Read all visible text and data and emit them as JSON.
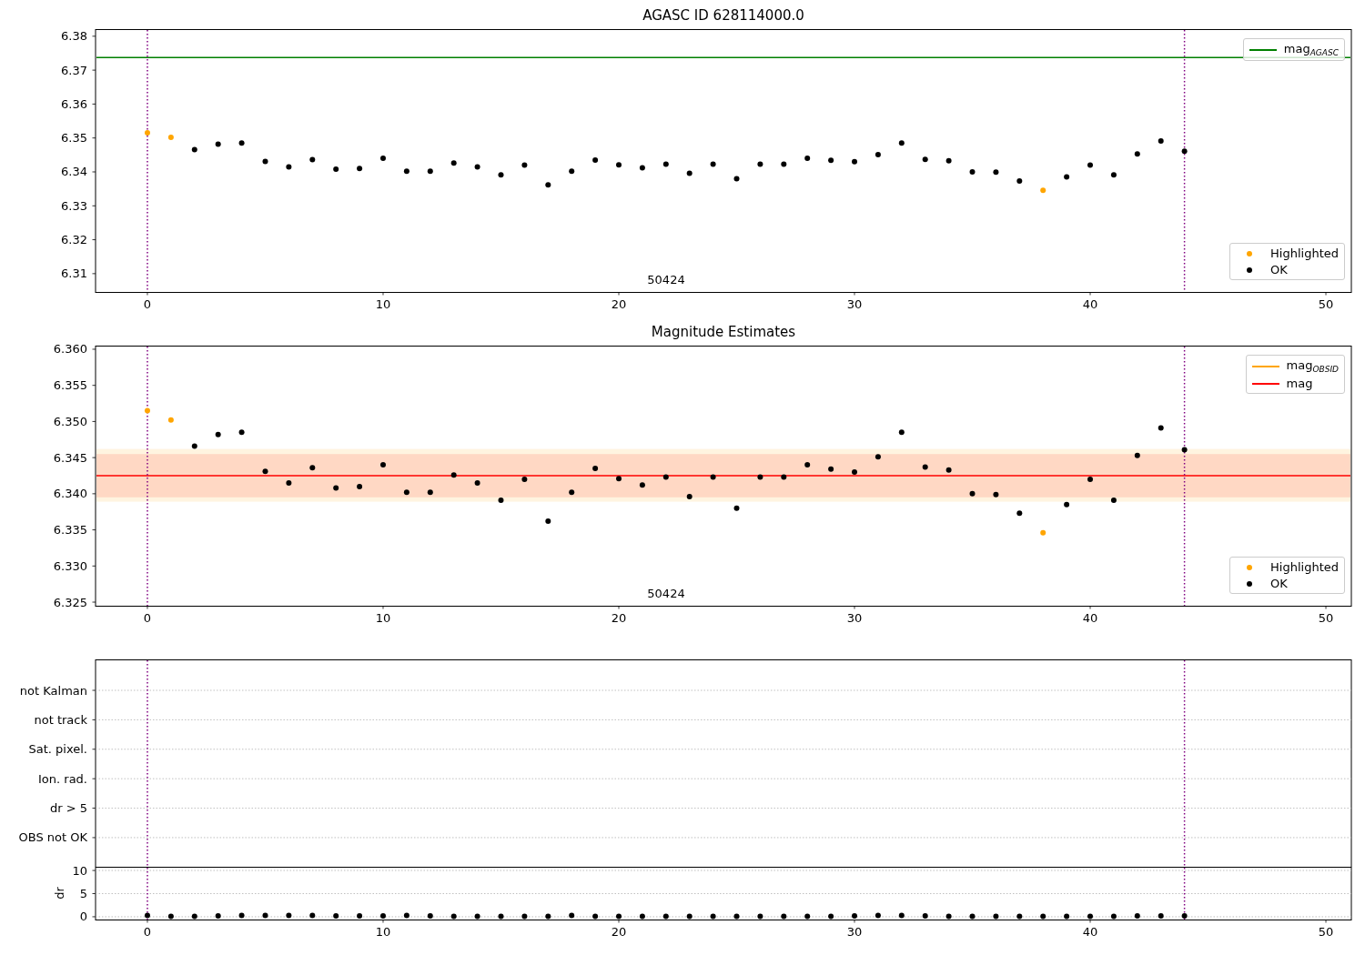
{
  "figure": {
    "panels": [
      {
        "chart_data": {
          "type": "scatter",
          "title": "AGASC ID 628114000.0",
          "legend": [
            "upper right",
            "lower right"
          ],
          "x": [
            0,
            1,
            2,
            3,
            4,
            5,
            6,
            7,
            8,
            9,
            10,
            11,
            12,
            13,
            14,
            15,
            16,
            17,
            18,
            19,
            20,
            21,
            22,
            23,
            24,
            25,
            26,
            27,
            28,
            29,
            30,
            31,
            32,
            33,
            34,
            35,
            36,
            37,
            38,
            39,
            40,
            41,
            42,
            43,
            44
          ],
          "xlim": [
            -2.2,
            51.08
          ],
          "ylim": [
            6.3046,
            6.3821
          ],
          "xticks": [
            0,
            10,
            20,
            30,
            40,
            50
          ],
          "yticks": [
            6.31,
            6.32,
            6.33,
            6.34,
            6.35,
            6.36,
            6.37,
            6.38
          ],
          "series": [
            {
              "name": "Highlighted",
              "color": "#ffa500",
              "values": [
                6.3515,
                6.3502,
                null,
                null,
                null,
                null,
                null,
                null,
                null,
                null,
                null,
                null,
                null,
                null,
                null,
                null,
                null,
                null,
                null,
                null,
                null,
                null,
                null,
                null,
                null,
                null,
                null,
                null,
                null,
                null,
                null,
                null,
                null,
                null,
                null,
                null,
                null,
                null,
                6.3346,
                null,
                null,
                null,
                null,
                null,
                null
              ]
            },
            {
              "name": "OK",
              "color": "#000000",
              "values": [
                null,
                null,
                6.3466,
                6.3482,
                6.3485,
                6.3431,
                6.3415,
                6.3436,
                6.3408,
                6.341,
                6.344,
                6.3402,
                6.3402,
                6.3426,
                6.3415,
                6.3391,
                6.342,
                6.3362,
                6.3402,
                6.3435,
                6.3421,
                6.3412,
                6.3423,
                6.3396,
                6.3423,
                6.338,
                6.3423,
                6.3423,
                6.344,
                6.3434,
                6.343,
                6.3451,
                6.3485,
                6.3437,
                6.3433,
                6.34,
                6.3399,
                6.3373,
                null,
                6.3385,
                6.342,
                6.3391,
                6.3453,
                6.3491,
                6.3461
              ]
            }
          ],
          "ref_lines": [
            {
              "axis": "y",
              "value": 6.3737,
              "label": "mag$_{AGASC}$",
              "color": "#008000"
            },
            {
              "axis": "x",
              "value": 0,
              "color": "#800080"
            },
            {
              "axis": "x",
              "value": 44,
              "color": "#800080"
            }
          ],
          "annotations": [
            "50424"
          ]
        }
      },
      {
        "chart_data": {
          "type": "scatter",
          "title": "Magnitude Estimates",
          "legend": [
            "upper right",
            "lower right"
          ],
          "x": [
            0,
            1,
            2,
            3,
            4,
            5,
            6,
            7,
            8,
            9,
            10,
            11,
            12,
            13,
            14,
            15,
            16,
            17,
            18,
            19,
            20,
            21,
            22,
            23,
            24,
            25,
            26,
            27,
            28,
            29,
            30,
            31,
            32,
            33,
            34,
            35,
            36,
            37,
            38,
            39,
            40,
            41,
            42,
            43,
            44
          ],
          "xlim": [
            -2.2,
            51.08
          ],
          "ylim": [
            6.3245,
            6.3605
          ],
          "xticks": [
            0,
            10,
            20,
            30,
            40,
            50
          ],
          "yticks": [
            6.325,
            {
              "value": 6.33,
              "label": "6.330"
            },
            6.335,
            {
              "value": 6.34,
              "label": "6.340"
            },
            6.345,
            {
              "value": 6.35,
              "label": "6.350"
            },
            6.355,
            {
              "value": 6.36,
              "label": "6.360"
            }
          ],
          "series": [
            {
              "name": "Highlighted",
              "color": "#ffa500",
              "values": [
                6.3515,
                6.3502,
                null,
                null,
                null,
                null,
                null,
                null,
                null,
                null,
                null,
                null,
                null,
                null,
                null,
                null,
                null,
                null,
                null,
                null,
                null,
                null,
                null,
                null,
                null,
                null,
                null,
                null,
                null,
                null,
                null,
                null,
                null,
                null,
                null,
                null,
                null,
                null,
                6.3346,
                null,
                null,
                null,
                null,
                null,
                null
              ]
            },
            {
              "name": "OK",
              "color": "#000000",
              "values": [
                null,
                null,
                6.3466,
                6.3482,
                6.3485,
                6.3431,
                6.3415,
                6.3436,
                6.3408,
                6.341,
                6.344,
                6.3402,
                6.3402,
                6.3426,
                6.3415,
                6.3391,
                6.342,
                6.3362,
                6.3402,
                6.3435,
                6.3421,
                6.3412,
                6.3423,
                6.3396,
                6.3423,
                6.338,
                6.3423,
                6.3423,
                6.344,
                6.3434,
                6.343,
                6.3451,
                6.3485,
                6.3437,
                6.3433,
                6.34,
                6.3399,
                6.3373,
                null,
                6.3385,
                6.342,
                6.3391,
                6.3453,
                6.3491,
                6.3461
              ]
            }
          ],
          "bands": [
            {
              "axis": "y",
              "from": 6.3395,
              "to": 6.3455,
              "color": "#ff0000"
            },
            {
              "axis": "y",
              "from": 6.3389,
              "to": 6.3462,
              "color": "#ffa500",
              "label": "mag$_{OBSID}$"
            }
          ],
          "ref_lines": [
            {
              "axis": "y",
              "value": 6.3425,
              "label": "mag",
              "color": "#ff0000"
            },
            {
              "axis": "x",
              "value": 0,
              "color": "#800080"
            },
            {
              "axis": "x",
              "value": 44,
              "color": "#800080"
            }
          ],
          "annotations": [
            "50424"
          ]
        }
      },
      {
        "chart_data": {
          "type": "scatter",
          "orientation": "horizontal",
          "xlim": [
            -2.2,
            51.08
          ],
          "grid": true,
          "categories": [
            "not Kalman",
            "not track",
            "Sat. pixel.",
            "Ion. rad.",
            "dr > 5",
            "OBS not OK"
          ],
          "ref_lines": [
            {
              "axis": "x",
              "value": 0,
              "color": "#800080"
            },
            {
              "axis": "x",
              "value": 44,
              "color": "#800080"
            }
          ]
        }
      },
      {
        "chart_data": {
          "type": "scatter",
          "ylabel": "dr",
          "x": [
            0,
            1,
            2,
            3,
            4,
            5,
            6,
            7,
            8,
            9,
            10,
            11,
            12,
            13,
            14,
            15,
            16,
            17,
            18,
            19,
            20,
            21,
            22,
            23,
            24,
            25,
            26,
            27,
            28,
            29,
            30,
            31,
            32,
            33,
            34,
            35,
            36,
            37,
            38,
            39,
            40,
            41,
            42,
            43,
            44
          ],
          "xlim": [
            -2.2,
            51.08
          ],
          "ylim": [
            -0.6,
            10.8
          ],
          "grid": true,
          "xticks": [
            0,
            10,
            20,
            30,
            40,
            50
          ],
          "yticks": [
            0,
            5,
            10
          ],
          "series": [
            {
              "color": "#000000",
              "values": [
                0.3,
                0.1,
                0.1,
                0.2,
                0.3,
                0.3,
                0.3,
                0.3,
                0.2,
                0.2,
                0.2,
                0.3,
                0.2,
                0.1,
                0.1,
                0.1,
                0.1,
                0.1,
                0.3,
                0.1,
                0.1,
                0.1,
                0.1,
                0.1,
                0.1,
                0.1,
                0.1,
                0.1,
                0.1,
                0.1,
                0.2,
                0.3,
                0.3,
                0.2,
                0.1,
                0.1,
                0.1,
                0.1,
                0.1,
                0.1,
                0.1,
                0.1,
                0.2,
                0.2,
                0.2
              ]
            }
          ],
          "ref_lines": [
            {
              "axis": "x",
              "value": 0,
              "color": "#800080"
            },
            {
              "axis": "x",
              "value": 44,
              "color": "#800080"
            }
          ]
        }
      }
    ]
  }
}
